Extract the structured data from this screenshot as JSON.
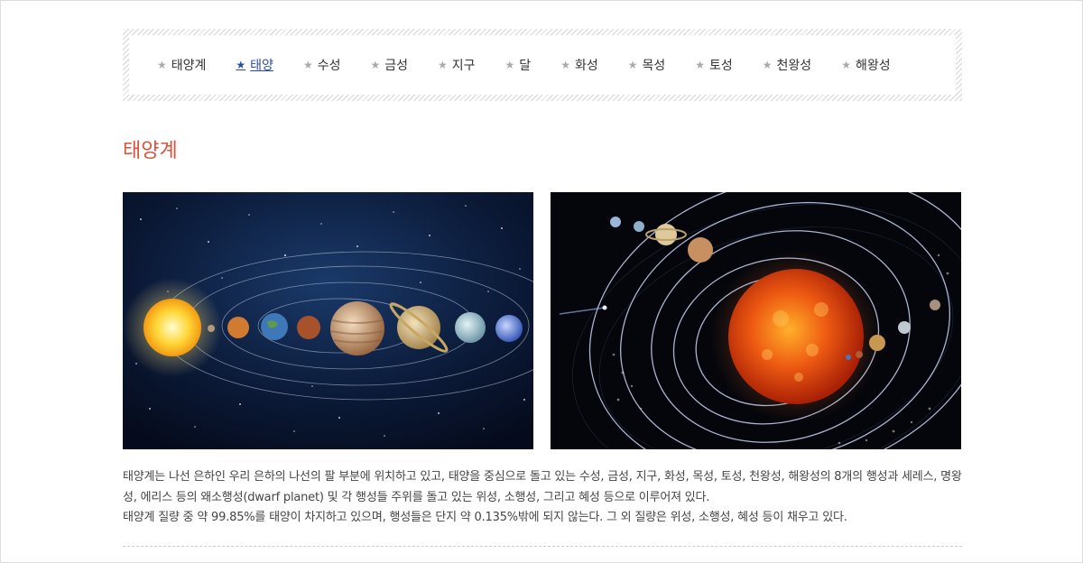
{
  "nav": {
    "items": [
      {
        "label": "태양계",
        "active": false
      },
      {
        "label": "태양",
        "active": true
      },
      {
        "label": "수성",
        "active": false
      },
      {
        "label": "금성",
        "active": false
      },
      {
        "label": "지구",
        "active": false
      },
      {
        "label": "달",
        "active": false
      },
      {
        "label": "화성",
        "active": false
      },
      {
        "label": "목성",
        "active": false
      },
      {
        "label": "토성",
        "active": false
      },
      {
        "label": "천왕성",
        "active": false
      },
      {
        "label": "해왕성",
        "active": false
      }
    ],
    "icon": "star-icon"
  },
  "page": {
    "title": "태양계"
  },
  "content": {
    "line1": "태양계는 나선 은하인 우리 은하의 나선의 팔 부분에 위치하고 있고, 태양을 중심으로 돌고 있는 수성, 금성, 지구, 화성, 목성, 토성, 천왕성, 해왕성의 8개의 행성과 세레스, 명왕성, 에리스 등의 왜소행성(dwarf planet) 및 각 행성들 주위를 돌고 있는 위성, 소행성, 그리고 혜성 등으로 이루어져 있다.",
    "line2": "태양계 질량 중 약 99.85%를 태양이 차지하고 있으며, 행성들은 단지 약 0.135%밖에 되지 않는다. 그 외 질량은 위성, 소행성, 혜성 등이 채우고 있다."
  },
  "colors": {
    "title": "#d9533b",
    "active_nav": "#2b4ba8",
    "text": "#333333"
  }
}
